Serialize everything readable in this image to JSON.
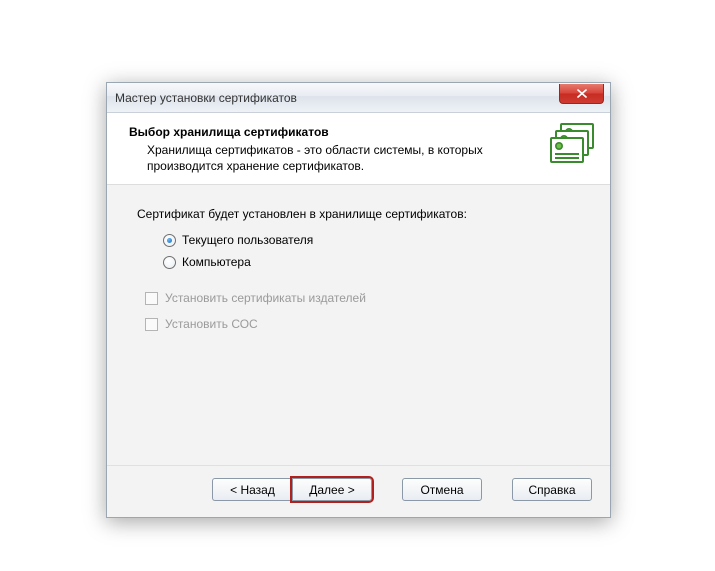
{
  "window": {
    "title": "Мастер установки сертификатов"
  },
  "header": {
    "title": "Выбор хранилища сертификатов",
    "description": "Хранилища сертификатов - это области системы, в которых производится хранение сертификатов."
  },
  "body": {
    "intro": "Сертификат будет установлен в хранилище сертификатов:",
    "radios": [
      {
        "label": "Текущего пользователя",
        "checked": true
      },
      {
        "label": "Компьютера",
        "checked": false
      }
    ],
    "checks": [
      {
        "label": "Установить сертификаты издателей",
        "enabled": false
      },
      {
        "label": "Установить СОС",
        "enabled": false
      }
    ]
  },
  "footer": {
    "back": "< Назад",
    "next": "Далее >",
    "cancel": "Отмена",
    "help": "Справка"
  }
}
